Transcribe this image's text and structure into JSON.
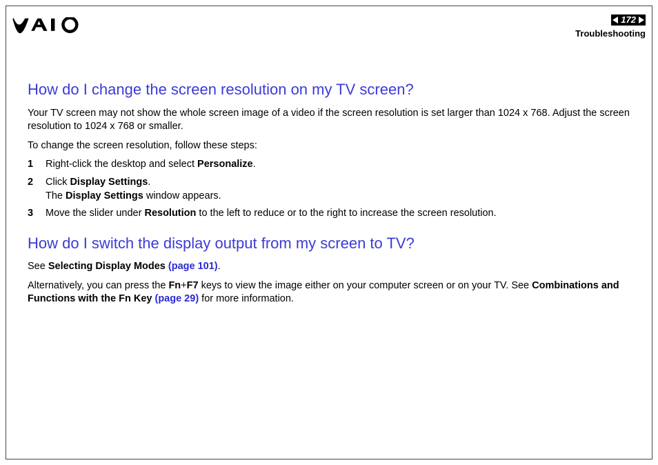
{
  "header": {
    "page_number": "172",
    "section": "Troubleshooting"
  },
  "section1": {
    "heading": "How do I change the screen resolution on my TV screen?",
    "intro": "Your TV screen may not show the whole screen image of a video if the screen resolution is set larger than 1024 x 768. Adjust the screen resolution to 1024 x 768 or smaller.",
    "lead_in": "To change the screen resolution, follow these steps:",
    "steps": [
      {
        "num": "1",
        "pre": "Right-click the desktop and select ",
        "bold1": "Personalize",
        "post": "."
      },
      {
        "num": "2",
        "pre": "Click ",
        "bold1": "Display Settings",
        "mid": ".",
        "line2_pre": "The ",
        "line2_bold": "Display Settings",
        "line2_post": " window appears."
      },
      {
        "num": "3",
        "pre": "Move the slider under ",
        "bold1": "Resolution",
        "post": " to the left to reduce or to the right to increase the screen resolution."
      }
    ]
  },
  "section2": {
    "heading": "How do I switch the display output from my screen to TV?",
    "p1_pre": "See ",
    "p1_bold": "Selecting Display Modes ",
    "p1_link": "(page 101)",
    "p1_post": ".",
    "p2_pre": "Alternatively, you can press the ",
    "p2_fn": "Fn",
    "p2_plus": "+",
    "p2_f7": "F7",
    "p2_mid": " keys to view the image either on your computer screen or on your TV. See ",
    "p2_bold": "Combinations and Functions with the Fn Key ",
    "p2_link": "(page 29)",
    "p2_post": " for more information."
  }
}
